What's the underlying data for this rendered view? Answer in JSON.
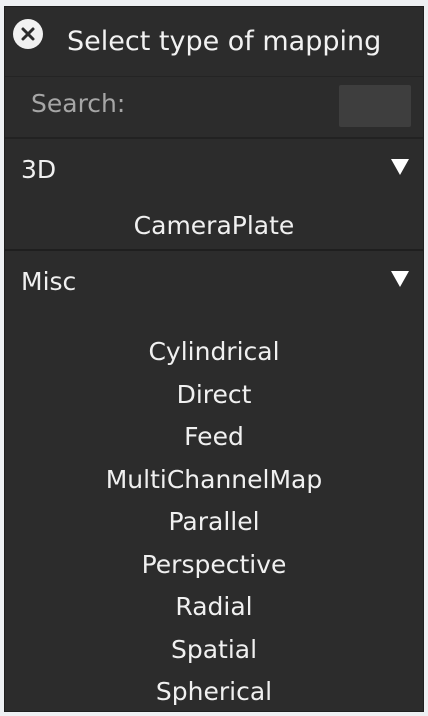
{
  "dialog": {
    "title": "Select type of mapping",
    "close_icon": "close-circle-icon"
  },
  "search": {
    "label": "Search:",
    "value": ""
  },
  "categories": [
    {
      "name": "3D",
      "expanded": true,
      "items": [
        "CameraPlate"
      ]
    },
    {
      "name": "Misc",
      "expanded": true,
      "items": [
        "Cylindrical",
        "Direct",
        "Feed",
        "MultiChannelMap",
        "Parallel",
        "Perspective",
        "Radial",
        "Spatial",
        "Spherical"
      ]
    }
  ],
  "colors": {
    "panel_bg": "#2c2c2c",
    "text": "#f0f0f0",
    "muted_text": "#a6a6a6",
    "input_bg": "#3e3e3e"
  }
}
